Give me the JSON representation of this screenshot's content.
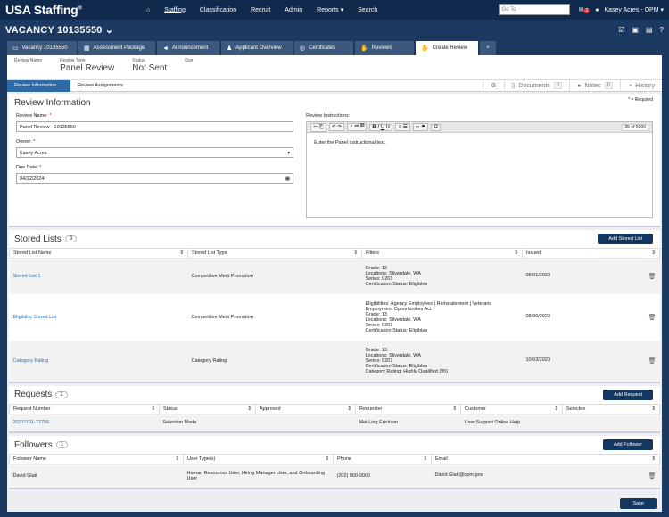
{
  "topnav": {
    "logo": "USA Staffing",
    "logo_mark": "®",
    "home_icon": "home-icon",
    "items": [
      "Staffing",
      "Classification",
      "Recruit",
      "Admin",
      "Reports",
      "Search"
    ],
    "goto_placeholder": "Go To",
    "mail_count": "2",
    "user": "Kasey Acres - OPM"
  },
  "vacancy": {
    "title": "VACANCY 10135550"
  },
  "tabs": [
    "Vacancy 10135550",
    "Assessment Package",
    "Announcement",
    "Applicant Overview",
    "Certificates",
    "Reviews",
    "Create Review"
  ],
  "tab_add": "+",
  "info": {
    "review_name_label": "Review Name",
    "review_type_label": "Review Type",
    "review_type": "Panel Review",
    "status_label": "Status",
    "status": "Not Sent",
    "due_label": "Due"
  },
  "crumbs": [
    "Review Information",
    "Review Assignments"
  ],
  "right_links": {
    "documents": "Documents",
    "documents_count": "0",
    "notes": "Notes",
    "notes_count": "0",
    "history": "History"
  },
  "review_info": {
    "title": "Review Information",
    "required_note": "* = Required",
    "review_name_label": "Review Name:",
    "review_name": "Panel Review - 10135550",
    "owner_label": "Owner:",
    "owner": "Kasey Acres",
    "due_label": "Due Date:",
    "due": "04/22/2024",
    "instructions_label": "Review Instructions:",
    "instructions_count": "35 of 5000",
    "instructions_text": "Enter the Panel instructional text."
  },
  "stored_lists": {
    "title": "Stored Lists",
    "count": "3",
    "add_label": "Add Stored List",
    "headers": [
      "Stored List Name",
      "Stored List Type",
      "Filters",
      "Issued"
    ],
    "rows": [
      {
        "name": "Stored List 1",
        "type": "Competitive Merit Promotion",
        "filters": [
          "Grade: 13",
          "Locations: Silverdale, WA",
          "Series: 0201",
          "Certification Status: Eligibles"
        ],
        "issued": "08/01/2023"
      },
      {
        "name": "Eligibility Stored List",
        "type": "Competitive Merit Promotion",
        "filters": [
          "Eligibilities: Agency Employees | Reinstatement | Veterans",
          "Employment Opportunities Act",
          "Grade: 13",
          "Locations: Silverdale, WA",
          "Series: 0201",
          "Certification Status: Eligibles"
        ],
        "issued": "08/30/2023"
      },
      {
        "name": "Category Rating",
        "type": "Category Rating",
        "filters": [
          "Grade: 13",
          "Locations: Silverdale, WA",
          "Series: 0201",
          "Certification Status: Eligibles",
          "Category Rating: Highly Qualified (95)"
        ],
        "issued": "10/03/2023"
      }
    ]
  },
  "requests": {
    "title": "Requests",
    "count": "1",
    "add_label": "Add Request",
    "headers": [
      "Request Number",
      "Status",
      "Approved",
      "Requester",
      "Customer",
      "Selectee"
    ],
    "rows": [
      {
        "number": "20211101-77756",
        "status": "Selection Made",
        "approved": "",
        "requester": "Mei-Ling Erickson",
        "customer": "User Support Online Help",
        "selectee": ""
      }
    ]
  },
  "followers": {
    "title": "Followers",
    "count": "1",
    "add_label": "Add Follower",
    "headers": [
      "Follower Name",
      "User Type(s)",
      "Phone",
      "Email"
    ],
    "rows": [
      {
        "name": "David Glatt",
        "types": "Human Resources User, Hiring Manager User, and Onboarding User",
        "phone": "(202) 000-0000",
        "email": "David.Glatt@opm.gov"
      }
    ]
  },
  "save_label": "Save"
}
